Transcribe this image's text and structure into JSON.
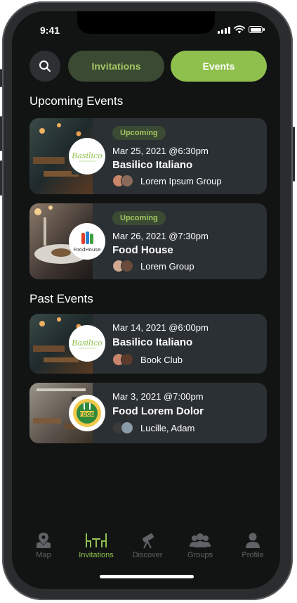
{
  "status_bar": {
    "time": "9:41"
  },
  "header": {
    "tabs": [
      {
        "label": "Invitations",
        "active": false
      },
      {
        "label": "Events",
        "active": true
      }
    ]
  },
  "sections": {
    "upcoming_title": "Upcoming Events",
    "past_title": "Past Events"
  },
  "upcoming_events": [
    {
      "badge": "Upcoming",
      "datetime": "Mar 25, 2021 @6:30pm",
      "name": "Basilico Italiano",
      "group": "Lorem Ipsum Group",
      "logo": "Basilico"
    },
    {
      "badge": "Upcoming",
      "datetime": "Mar 26, 2021 @7:30pm",
      "name": "Food House",
      "group": "Lorem Group",
      "logo": "FoodHouse"
    }
  ],
  "past_events": [
    {
      "datetime": "Mar 14, 2021 @6:00pm",
      "name": "Basilico Italiano",
      "group": "Book Club",
      "logo": "Basilico"
    },
    {
      "datetime": "Mar 3, 2021 @7:00pm",
      "name": "Food Lorem Dolor",
      "group": "Lucille, Adam",
      "logo": "FOOD"
    }
  ],
  "bottom_nav": [
    {
      "label": "Map",
      "icon": "map-pin-icon",
      "active": false
    },
    {
      "label": "Invitations",
      "icon": "dining-table-icon",
      "active": true
    },
    {
      "label": "Discover",
      "icon": "telescope-icon",
      "active": false
    },
    {
      "label": "Groups",
      "icon": "group-icon",
      "active": false
    },
    {
      "label": "Profile",
      "icon": "person-icon",
      "active": false
    }
  ],
  "colors": {
    "accent": "#8fc04e",
    "accent_text": "#a3c765",
    "badge_bg": "#3b4a32",
    "card_bg": "#2b3034",
    "screen_bg": "#121414"
  }
}
